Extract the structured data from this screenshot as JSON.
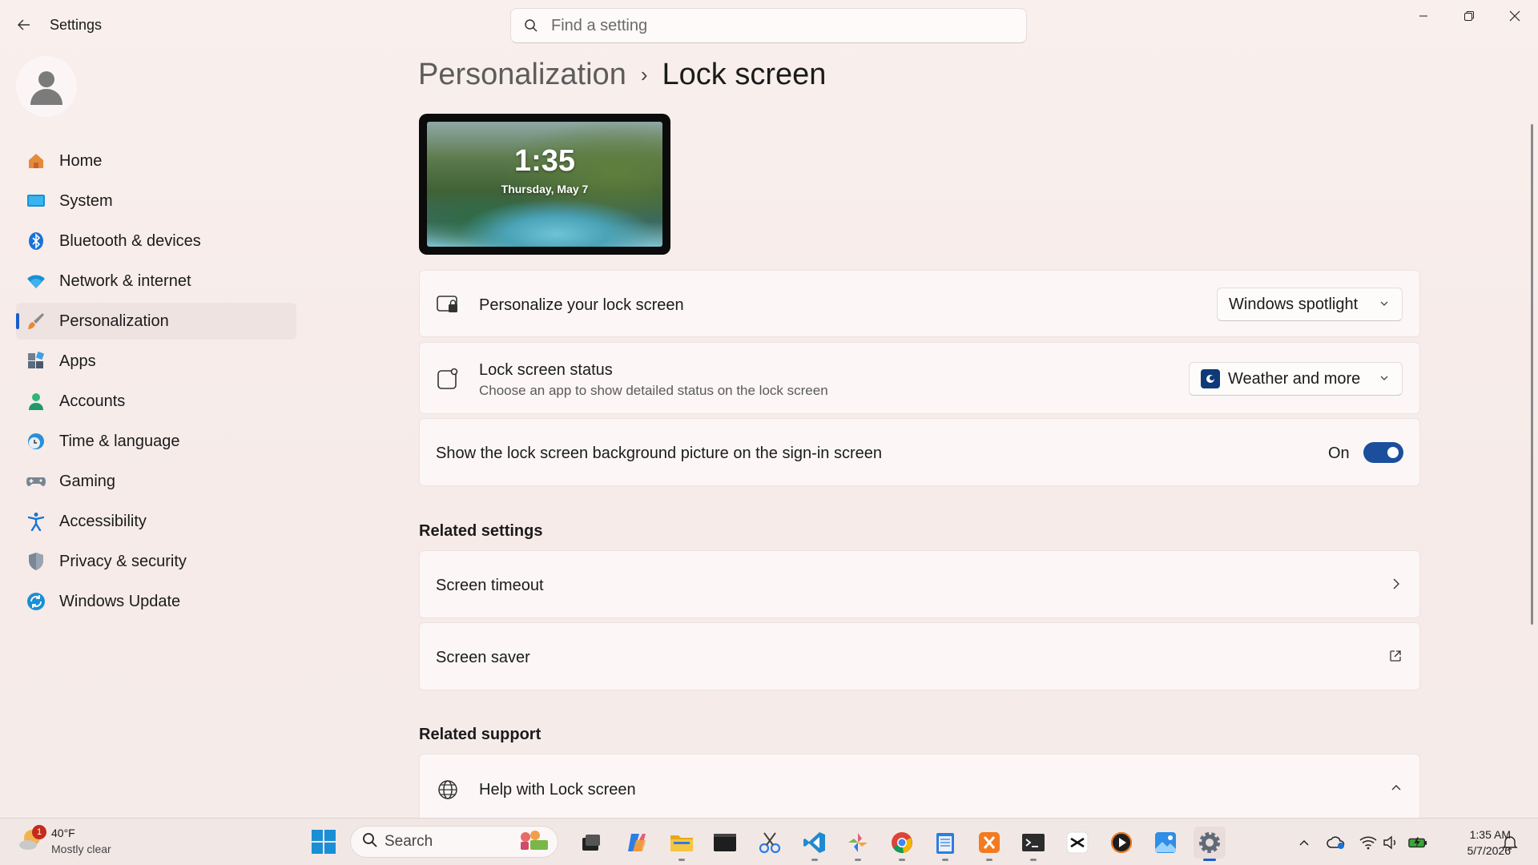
{
  "window": {
    "title": "Settings",
    "search_placeholder": "Find a setting"
  },
  "sidebar": {
    "items": [
      {
        "label": "Home",
        "icon": "home-icon",
        "active": false
      },
      {
        "label": "System",
        "icon": "system-icon",
        "active": false
      },
      {
        "label": "Bluetooth & devices",
        "icon": "bluetooth-icon",
        "active": false
      },
      {
        "label": "Network & internet",
        "icon": "wifi-icon",
        "active": false
      },
      {
        "label": "Personalization",
        "icon": "brush-icon",
        "active": true
      },
      {
        "label": "Apps",
        "icon": "apps-icon",
        "active": false
      },
      {
        "label": "Accounts",
        "icon": "account-icon",
        "active": false
      },
      {
        "label": "Time & language",
        "icon": "globe-clock-icon",
        "active": false
      },
      {
        "label": "Gaming",
        "icon": "gamepad-icon",
        "active": false
      },
      {
        "label": "Accessibility",
        "icon": "accessibility-icon",
        "active": false
      },
      {
        "label": "Privacy & security",
        "icon": "shield-icon",
        "active": false
      },
      {
        "label": "Windows Update",
        "icon": "update-icon",
        "active": false
      }
    ]
  },
  "breadcrumb": {
    "parent": "Personalization",
    "separator": "›",
    "current": "Lock screen"
  },
  "preview": {
    "time": "1:35",
    "date": "Thursday, May 7"
  },
  "settings": {
    "personalize": {
      "title": "Personalize your lock screen",
      "value": "Windows spotlight"
    },
    "status": {
      "title": "Lock screen status",
      "subtitle": "Choose an app to show detailed status on the lock screen",
      "value": "Weather and more"
    },
    "signin_background": {
      "title": "Show the lock screen background picture on the sign-in screen",
      "state_label": "On",
      "enabled": true
    }
  },
  "related_settings": {
    "heading": "Related settings",
    "items": [
      {
        "label": "Screen timeout",
        "icon": "chevron-right-icon"
      },
      {
        "label": "Screen saver",
        "icon": "external-link-icon"
      }
    ]
  },
  "related_support": {
    "heading": "Related support",
    "items": [
      {
        "label": "Help with Lock screen",
        "icon": "globe-icon"
      }
    ]
  },
  "taskbar": {
    "weather": {
      "temp": "40°F",
      "condition": "Mostly clear",
      "badge": "1"
    },
    "search_label": "Search",
    "clock": {
      "time": "1:35 AM",
      "date": "5/7/2026"
    }
  },
  "colors": {
    "accent": "#1b5ec8",
    "toggle_on": "#1b4f9c",
    "background": "#f7ecea"
  }
}
